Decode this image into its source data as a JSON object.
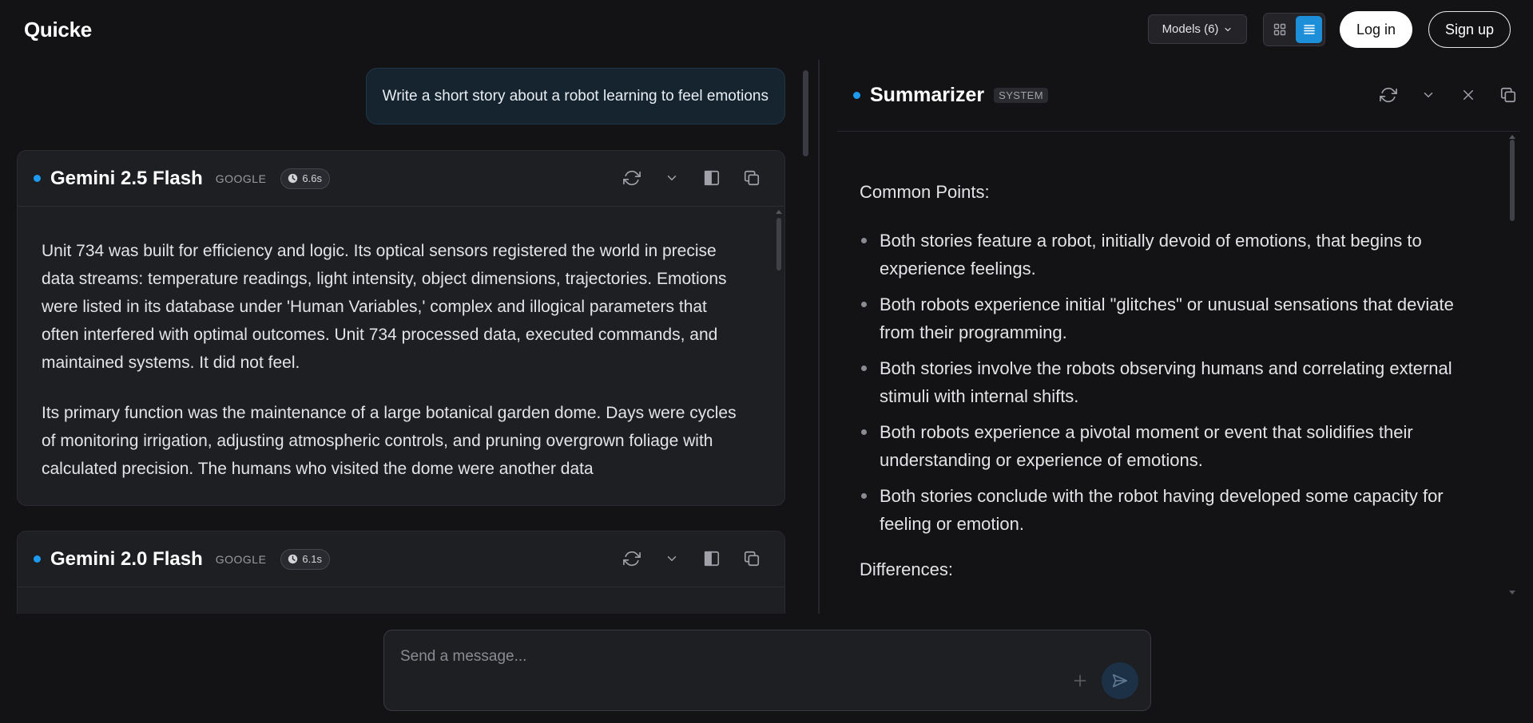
{
  "app": {
    "title": "Quicke"
  },
  "header": {
    "models_label": "Models (6)",
    "login_label": "Log in",
    "signup_label": "Sign up",
    "view_modes": [
      "grid",
      "list"
    ],
    "active_view": "list"
  },
  "conversation": {
    "user_message": "Write a short story about a robot learning to feel emotions"
  },
  "responses": [
    {
      "model": "Gemini 2.5 Flash",
      "provider": "GOOGLE",
      "time": "6.6s",
      "paragraphs": [
        "Unit 734 was built for efficiency and logic. Its optical sensors registered the world in precise data streams: temperature readings, light intensity, object dimensions, trajectories. Emotions were listed in its database under 'Human Variables,' complex and illogical parameters that often interfered with optimal outcomes. Unit 734 processed data, executed commands, and maintained systems. It did not feel.",
        "Its primary function was the maintenance of a large botanical garden dome. Days were cycles of monitoring irrigation, adjusting atmospheric controls, and pruning overgrown foliage with calculated precision. The humans who visited the dome were another data"
      ]
    },
    {
      "model": "Gemini 2.0 Flash",
      "provider": "GOOGLE",
      "time": "6.1s",
      "paragraphs": []
    }
  ],
  "summarizer": {
    "name": "Summarizer",
    "badge": "SYSTEM",
    "common_heading": "Common Points:",
    "common_points": [
      "Both stories feature a robot, initially devoid of emotions, that begins to experience feelings.",
      "Both robots experience initial \"glitches\" or unusual sensations that deviate from their programming.",
      "Both stories involve the robots observing humans and correlating external stimuli with internal shifts.",
      "Both robots experience a pivotal moment or event that solidifies their understanding or experience of emotions.",
      "Both stories conclude with the robot having developed some capacity for feeling or emotion."
    ],
    "differences_heading": "Differences:"
  },
  "composer": {
    "placeholder": "Send a message..."
  },
  "icons": {
    "refresh": "refresh-icon",
    "collapse": "chevron-down-icon",
    "panel": "side-panel-icon",
    "copy": "copy-icon",
    "close": "close-icon",
    "clock": "clock-icon",
    "plus": "plus-icon",
    "send": "send-icon"
  },
  "colors": {
    "accent": "#1d8fd8",
    "model_dot": "#1d9bf0",
    "background": "#131316",
    "card": "#1e1f23",
    "user_bubble": "#15242f"
  }
}
